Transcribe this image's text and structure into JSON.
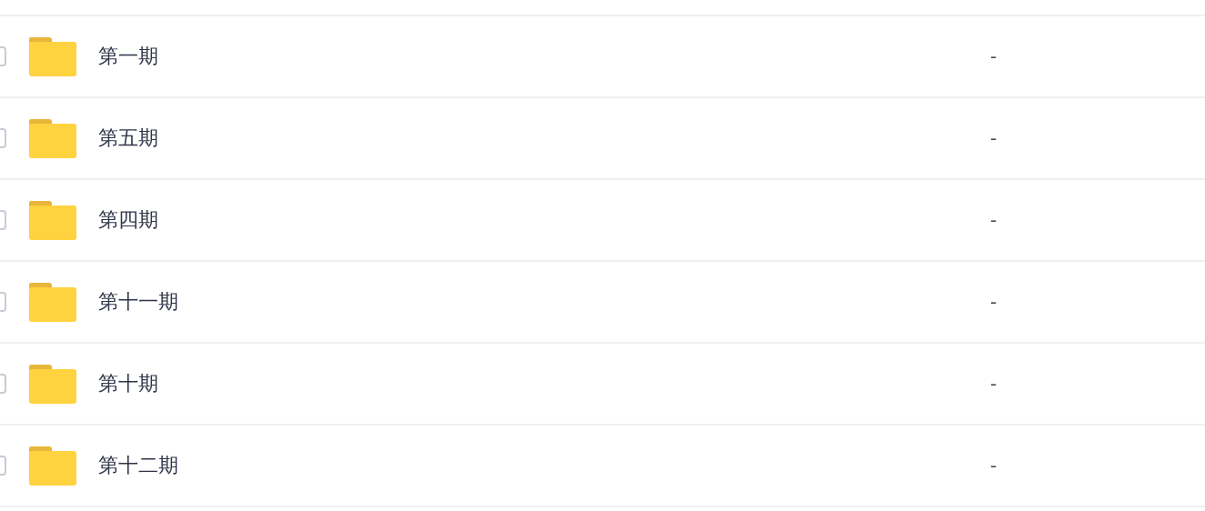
{
  "rows": [
    {
      "name": "第一期",
      "checked": false,
      "column_2": "-"
    },
    {
      "name": "第五期",
      "checked": false,
      "column_2": "-"
    },
    {
      "name": "第四期",
      "checked": false,
      "column_2": "-"
    },
    {
      "name": "第十一期",
      "checked": false,
      "column_2": "-"
    },
    {
      "name": "第十期",
      "checked": false,
      "column_2": "-"
    },
    {
      "name": "第十二期",
      "checked": false,
      "column_2": "-"
    }
  ]
}
